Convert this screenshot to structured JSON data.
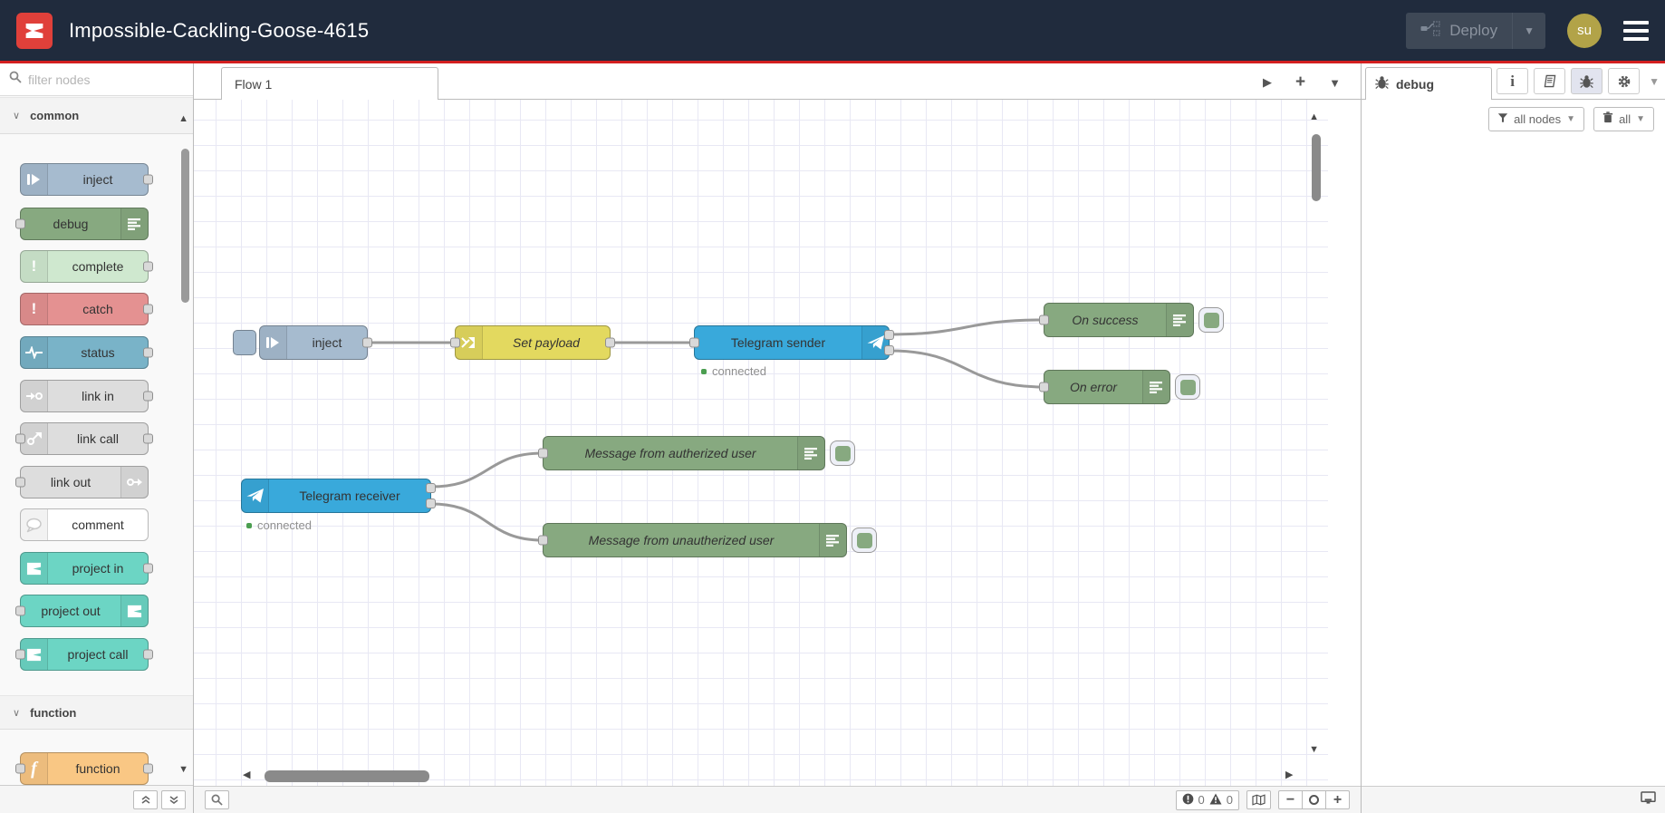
{
  "header": {
    "title": "Impossible-Cackling-Goose-4615",
    "deploy_label": "Deploy",
    "avatar_initials": "su"
  },
  "palette": {
    "search_placeholder": "filter nodes",
    "categories": [
      {
        "label": "common",
        "items": [
          {
            "label": "inject"
          },
          {
            "label": "debug"
          },
          {
            "label": "complete"
          },
          {
            "label": "catch"
          },
          {
            "label": "status"
          },
          {
            "label": "link in"
          },
          {
            "label": "link call"
          },
          {
            "label": "link out"
          },
          {
            "label": "comment"
          },
          {
            "label": "project in"
          },
          {
            "label": "project out"
          },
          {
            "label": "project call"
          }
        ]
      },
      {
        "label": "function",
        "items": [
          {
            "label": "function"
          }
        ]
      }
    ]
  },
  "canvas": {
    "tab_label": "Flow 1",
    "nodes": {
      "inject": {
        "label": "inject"
      },
      "set_payload": {
        "label": "Set payload"
      },
      "telegram_sender": {
        "label": "Telegram sender",
        "status": "connected"
      },
      "on_success": {
        "label": "On success"
      },
      "on_error": {
        "label": "On error"
      },
      "telegram_receiver": {
        "label": "Telegram receiver",
        "status": "connected"
      },
      "msg_authorized": {
        "label": "Message from autherized user"
      },
      "msg_unauthorized": {
        "label": "Message from unautherized user"
      }
    },
    "footer": {
      "error_count": "0",
      "warning_count": "0"
    }
  },
  "sidebar": {
    "tab_label": "debug",
    "filter_label": "all nodes",
    "clear_label": "all"
  },
  "colors": {
    "header_bg": "#202b3d",
    "accent_red": "#d32020",
    "logo_red": "#e0403a",
    "avatar_bg": "#b2a348",
    "node_inject": "#a6bbcf",
    "node_debug": "#87a980",
    "node_complete": "#cfe8cf",
    "node_catch": "#e49191",
    "node_status": "#79b3c8",
    "node_link": "#dddddd",
    "node_comment": "#ffffff",
    "node_project": "#6cd5c4",
    "node_function": "#f9c784",
    "node_change": "#e3d95f",
    "node_telegram": "#39a9db",
    "wire": "#999999",
    "status_dot": "#4b9e50"
  }
}
